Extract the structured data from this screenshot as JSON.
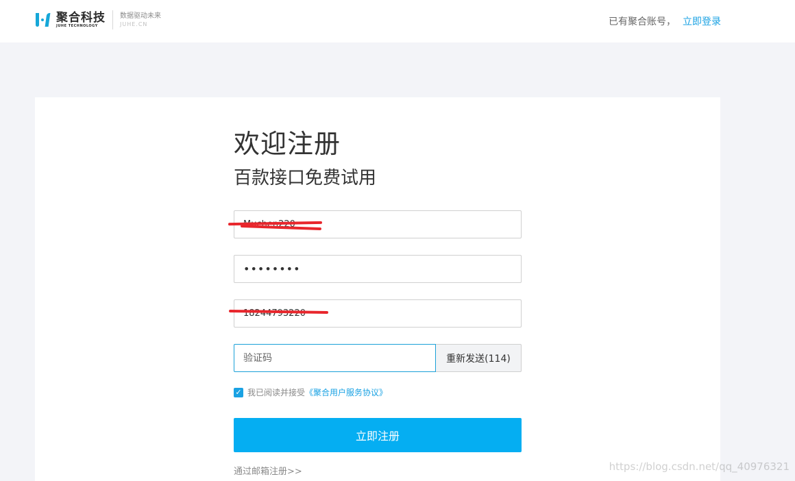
{
  "header": {
    "logo_name": "聚合科技",
    "logo_sub": "JUHE TECHNOLOGY",
    "slogan_cn": "数据驱动未来",
    "slogan_en": "JUHE.CN",
    "have_account": "已有聚合账号，",
    "login_link": "立即登录"
  },
  "form": {
    "title": "欢迎注册",
    "subtitle": "百款接口免费试用",
    "username_value": "Muchen220",
    "password_value": "••••••••",
    "phone_value": "18244793220",
    "code_placeholder": "验证码",
    "resend_label": "重新发送(114)",
    "agree_text": "我已阅读并接受",
    "agree_link": "《聚合用户服务协议》",
    "register_label": "立即注册",
    "email_register": "通过邮箱注册>>"
  },
  "watermark": "https://blog.csdn.net/qq_40976321",
  "colors": {
    "accent": "#05aef2",
    "link": "#1aa2e3",
    "redaction": "#e8262c"
  }
}
